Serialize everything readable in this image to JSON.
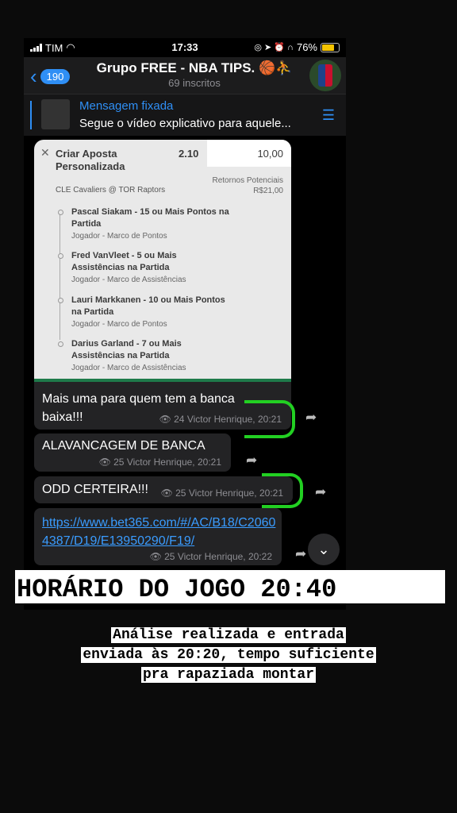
{
  "status": {
    "carrier": "TIM",
    "time": "17:33",
    "battery": "76%"
  },
  "header": {
    "back_count": "190",
    "title": "Grupo FREE - NBA TIPS. 🏀⛹",
    "subtitle": "69 inscritos"
  },
  "pinned": {
    "label": "Mensagem fixada",
    "text": "Segue o vídeo explicativo para aquele..."
  },
  "bet": {
    "title": "Criar Aposta Personalizada",
    "odds": "2.10",
    "stake": "10,00",
    "match": "CLE Cavaliers @ TOR Raptors",
    "returns_label": "Retornos Potenciais",
    "returns_value": "R$21,00",
    "selections": [
      {
        "name": "Pascal Siakam  - 15 ou Mais Pontos na Partida",
        "type": "Jogador - Marco de Pontos"
      },
      {
        "name": "Fred VanVleet  - 5 ou Mais Assistências na Partida",
        "type": "Jogador - Marco de Assistências"
      },
      {
        "name": "Lauri Markkanen  - 10 ou Mais Pontos na Partida",
        "type": "Jogador - Marco de Pontos"
      },
      {
        "name": "Darius Garland  - 7 ou Mais Assistências na Partida",
        "type": "Jogador - Marco de Assistências"
      }
    ]
  },
  "messages": [
    {
      "text": "Mais uma para quem tem a banca baixa!!!",
      "meta": "👁 24 Victor Henrique, 20:21"
    },
    {
      "text": "ALAVANCAGEM DE BANCA",
      "meta": "👁 25 Victor Henrique, 20:21"
    },
    {
      "text": "ODD CERTEIRA!!!",
      "meta": "👁 25 Victor Henrique, 20:21"
    },
    {
      "text": "https://www.bet365.com/#/AC/B18/C20604387/D19/E13950290/F19/",
      "meta": "👁 25 Victor Henrique, 20:22"
    }
  ],
  "banner": "HORÁRIO DO JOGO 20:40",
  "caption": [
    "Análise realizada e entrada",
    "enviada às 20:20, tempo suficiente",
    "pra rapaziada montar"
  ],
  "colors": {
    "accent": "#2f8ff5",
    "highlight": "#22d022",
    "bubble": "#232325"
  }
}
